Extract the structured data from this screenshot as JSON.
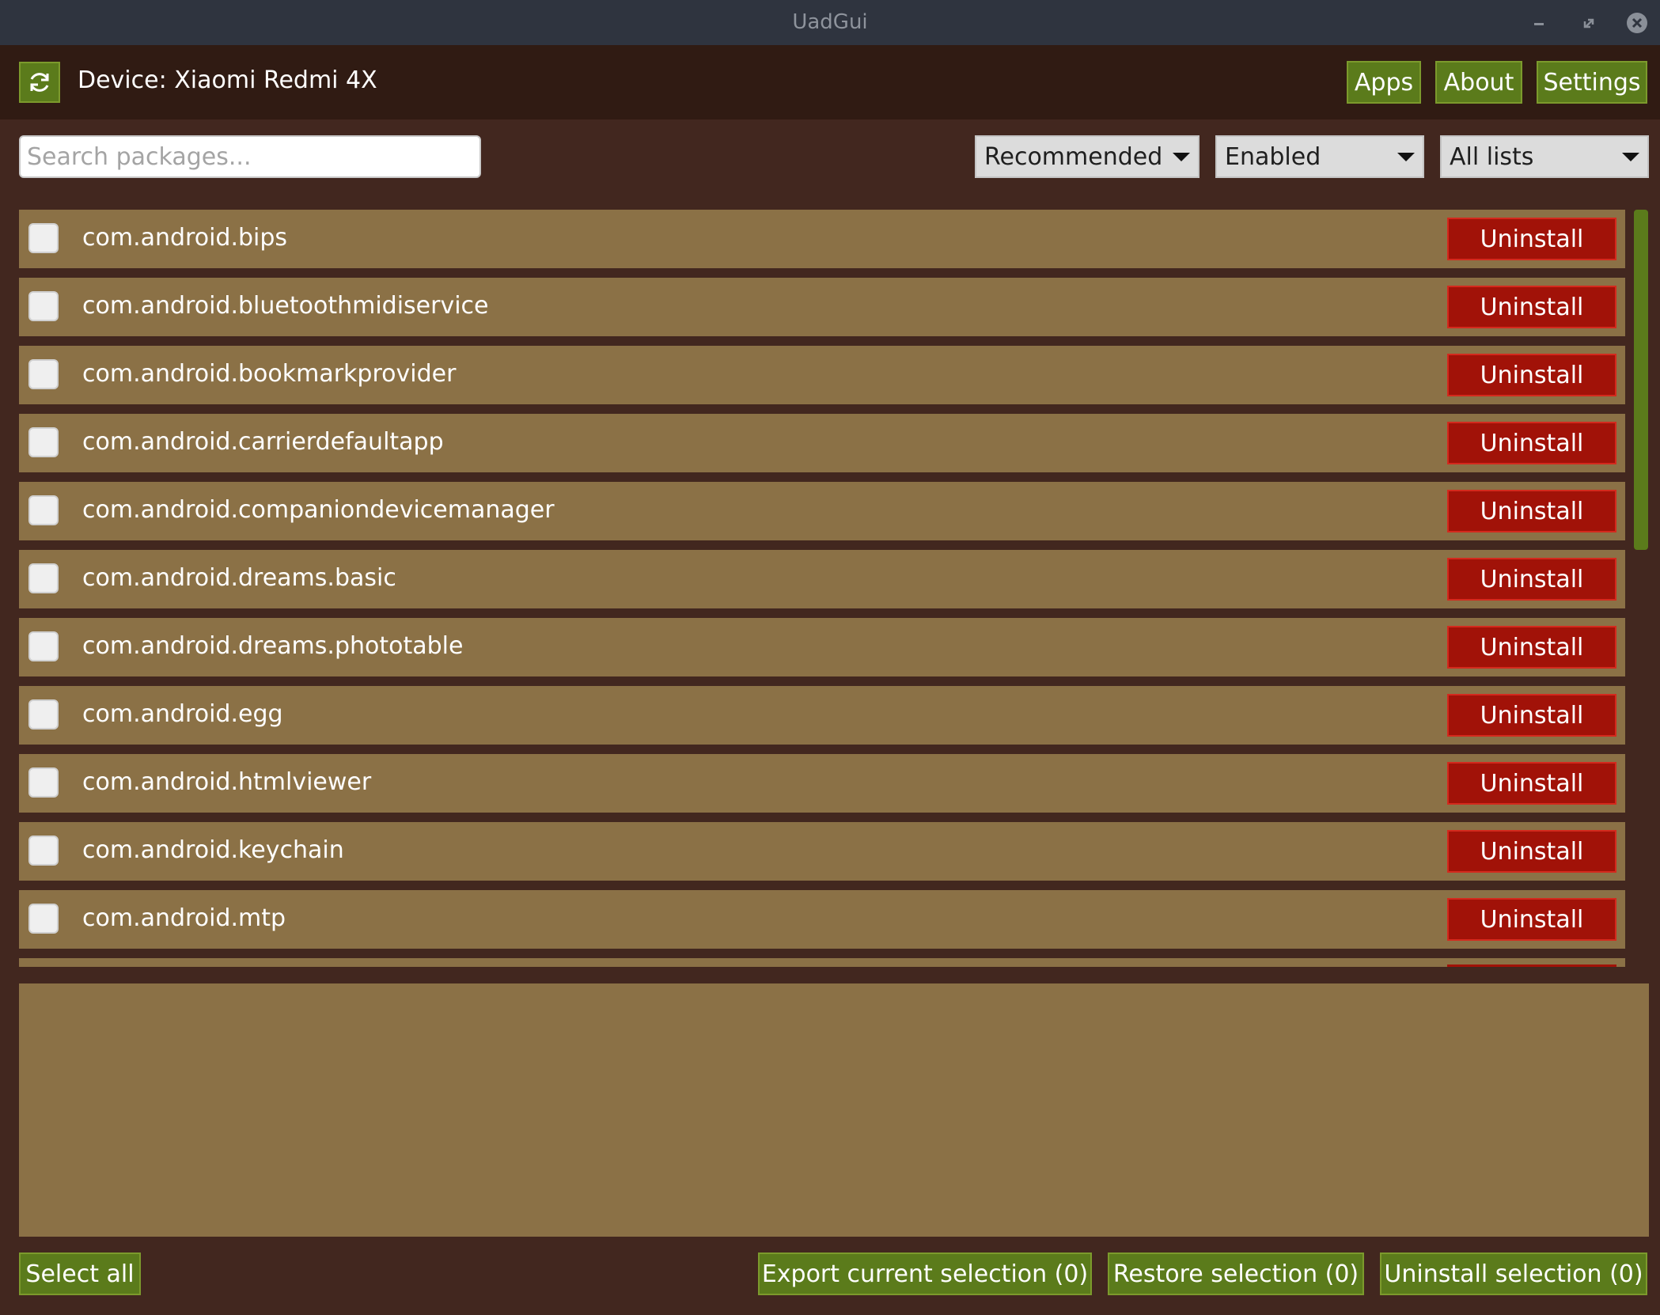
{
  "window": {
    "title": "UadGui",
    "controls": [
      "minimize-icon",
      "maximize-icon",
      "close-icon"
    ]
  },
  "header": {
    "refresh_icon": "refresh-icon",
    "device_label": "Device: Xiaomi Redmi 4X",
    "nav": {
      "apps": "Apps",
      "about": "About",
      "settings": "Settings"
    }
  },
  "filters": {
    "search_placeholder": "Search packages...",
    "search_value": "",
    "recommendation": "Recommended",
    "state": "Enabled",
    "list": "All lists"
  },
  "packages": [
    {
      "name": "com.android.bips",
      "action": "Uninstall",
      "checked": false
    },
    {
      "name": "com.android.bluetoothmidiservice",
      "action": "Uninstall",
      "checked": false
    },
    {
      "name": "com.android.bookmarkprovider",
      "action": "Uninstall",
      "checked": false
    },
    {
      "name": "com.android.carrierdefaultapp",
      "action": "Uninstall",
      "checked": false
    },
    {
      "name": "com.android.companiondevicemanager",
      "action": "Uninstall",
      "checked": false
    },
    {
      "name": "com.android.dreams.basic",
      "action": "Uninstall",
      "checked": false
    },
    {
      "name": "com.android.dreams.phototable",
      "action": "Uninstall",
      "checked": false
    },
    {
      "name": "com.android.egg",
      "action": "Uninstall",
      "checked": false
    },
    {
      "name": "com.android.htmlviewer",
      "action": "Uninstall",
      "checked": false
    },
    {
      "name": "com.android.keychain",
      "action": "Uninstall",
      "checked": false
    },
    {
      "name": "com.android.mtp",
      "action": "Uninstall",
      "checked": false
    }
  ],
  "footer": {
    "select_all": "Select all",
    "export": "Export current selection (0)",
    "restore": "Restore selection (0)",
    "uninstall": "Uninstall selection (0)"
  },
  "colors": {
    "background": "#42271f",
    "header": "#301b13",
    "row": "#8b7146",
    "accent_green": "#5b7b1b",
    "danger_red": "#a11208"
  }
}
